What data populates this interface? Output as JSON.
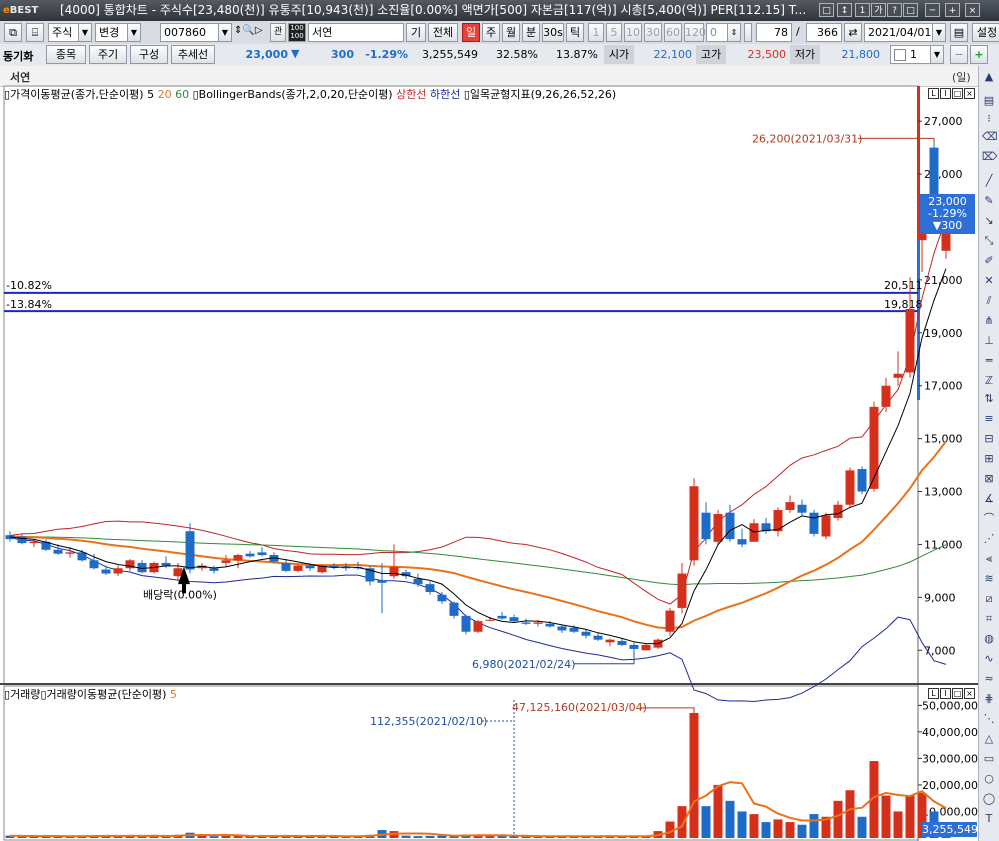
{
  "window": {
    "logo_prefix": "e",
    "logo_rest": "BEST",
    "title": "[4000] 통합차트 - 주식수[23,480(천)] 유통주[10,943(천)] 소진율[0.00%] 액면가[500] 자본금[117(억)] 시총[5,400(억)] PER[112.15] T..."
  },
  "toolbar": {
    "market": "주식",
    "change_btn": "변경",
    "code": "007860",
    "stock_name": "서연",
    "btn_gi": "기",
    "btn_all": "전체",
    "periods": [
      "일",
      "주",
      "월",
      "분",
      "30s",
      "틱"
    ],
    "active_period": "일",
    "minute_steps": [
      "1",
      "5",
      "10",
      "30",
      "60",
      "120"
    ],
    "offset": "0",
    "count_shown": "78",
    "count_total": "366",
    "date": "2021/04/01",
    "save_label": "설정"
  },
  "quotebar": {
    "sync_label": "동기화",
    "item_btn": "종목",
    "period_btn": "주기",
    "config_btn": "구성",
    "trend_btn": "추세선",
    "price": "23,000",
    "change": "300",
    "change_pct": "-1.29%",
    "volume": "3,255,549",
    "ratio1": "32.58%",
    "ratio2": "13.87%",
    "open_label": "시가",
    "open": "22,100",
    "high_label": "고가",
    "high": "23,500",
    "low_label": "저가",
    "low": "21,800",
    "pane_count": "1"
  },
  "chart_header": {
    "name": "서연",
    "unit": "(일)",
    "ma_label": "가격이동평균(종가,단순이평)",
    "ma_periods": [
      "5",
      "20",
      "60"
    ],
    "bb_label": "BollingerBands(종가,2,0,20,단순이평)",
    "bb_upper": "상한선",
    "bb_lower": "하한선",
    "ichimoku_label": "일목균형지표(9,26,26,52,26)"
  },
  "volume_header": {
    "label1": "거래량",
    "label2": "거래량이동평균(단순이평)",
    "period": "5"
  },
  "annotations": {
    "high": "26,200(2021/03/31)",
    "low": "6,980(2021/02/24)",
    "dividend": "배당락(0.00%)",
    "line1_pct": "-10.82%",
    "line1_val": "20,511",
    "line2_pct": "-13.84%",
    "line2_val": "19,818",
    "vol_max": "47,125,160(2021/03/04)",
    "vol_ref": "112,355(2021/02/10)",
    "price_box": [
      "23,000",
      "-1.29%",
      "▼300"
    ],
    "vol_box": "3,255,549"
  },
  "colors": {
    "up": "#d5301b",
    "down": "#1f6cc8",
    "ma5": "#000000",
    "ma20": "#e8731a",
    "ma60": "#2e8b3a",
    "bb_upper": "#c0262a",
    "bb_lower": "#1e2a9a",
    "hline": "#1d25c8"
  },
  "chart_data": {
    "type": "candlestick",
    "price_axis": {
      "ticks": [
        7000,
        9000,
        11000,
        13000,
        15000,
        17000,
        19000,
        21000,
        23000,
        25000,
        27000
      ],
      "labels": [
        "7,000",
        "9,000",
        "11,000",
        "13,000",
        "15,000",
        "17,000",
        "19,000",
        "21,000",
        "23,000",
        "25,000",
        "27,000"
      ],
      "range": [
        5800,
        27800
      ]
    },
    "volume_axis": {
      "ticks": [
        10000000,
        20000000,
        30000000,
        40000000,
        50000000
      ],
      "labels": [
        "10,000,000",
        "20,000,000",
        "30,000,000",
        "40,000,000",
        "50,000,000"
      ],
      "range": [
        0,
        52000000
      ]
    },
    "hlines": [
      20511,
      19818
    ],
    "candles": [
      [
        11350,
        11500,
        11100,
        11200,
        900000
      ],
      [
        11300,
        11400,
        11000,
        11050,
        700000
      ],
      [
        11050,
        11200,
        10900,
        11100,
        600000
      ],
      [
        11100,
        11200,
        10750,
        10800,
        800000
      ],
      [
        10800,
        11000,
        10600,
        10650,
        700000
      ],
      [
        10650,
        10900,
        10500,
        10700,
        600000
      ],
      [
        10700,
        10800,
        10350,
        10400,
        800000
      ],
      [
        10400,
        10650,
        10050,
        10100,
        900000
      ],
      [
        10050,
        10200,
        9850,
        9900,
        1000000
      ],
      [
        9900,
        10200,
        9800,
        10100,
        700000
      ],
      [
        10100,
        10450,
        10000,
        10400,
        800000
      ],
      [
        10300,
        10400,
        9900,
        9950,
        600000
      ],
      [
        9950,
        10350,
        9900,
        10300,
        1000000
      ],
      [
        10300,
        10550,
        10100,
        10200,
        700000
      ],
      [
        9800,
        10300,
        9600,
        10100,
        1200000
      ],
      [
        11500,
        11800,
        9900,
        10050,
        2000000
      ],
      [
        10100,
        10300,
        10000,
        10200,
        800000
      ],
      [
        10100,
        10200,
        9900,
        10000,
        700000
      ],
      [
        10300,
        10600,
        10150,
        10400,
        900000
      ],
      [
        10400,
        10650,
        10100,
        10600,
        800000
      ],
      [
        10650,
        10750,
        10500,
        10550,
        600000
      ],
      [
        10700,
        10900,
        10550,
        10600,
        700000
      ],
      [
        10600,
        10700,
        10300,
        10350,
        800000
      ],
      [
        10300,
        10450,
        9950,
        10000,
        1000000
      ],
      [
        10000,
        10250,
        9950,
        10200,
        700000
      ],
      [
        10200,
        10300,
        10000,
        10100,
        600000
      ],
      [
        9950,
        10250,
        9900,
        10200,
        800000
      ],
      [
        10200,
        10300,
        10050,
        10150,
        700000
      ],
      [
        10150,
        10300,
        10000,
        10100,
        600000
      ],
      [
        10150,
        10350,
        10050,
        10100,
        700000
      ],
      [
        10100,
        10200,
        9450,
        9600,
        1200000
      ],
      [
        9650,
        10300,
        8400,
        9550,
        3000000
      ],
      [
        9800,
        11000,
        9700,
        10150,
        2600000
      ],
      [
        9950,
        10050,
        9700,
        9800,
        900000
      ],
      [
        9700,
        9900,
        9400,
        9500,
        700000
      ],
      [
        9500,
        9600,
        9100,
        9200,
        800000
      ],
      [
        9100,
        9200,
        8750,
        8850,
        900000
      ],
      [
        8800,
        8850,
        8200,
        8300,
        1100000
      ],
      [
        8300,
        8350,
        7600,
        7700,
        1300000
      ],
      [
        7700,
        8150,
        7650,
        8100,
        1000000
      ],
      [
        8150,
        8250,
        8100,
        8150,
        800000
      ],
      [
        8300,
        8450,
        8150,
        8200,
        800000
      ],
      [
        8250,
        8350,
        8050,
        8100,
        700000
      ],
      [
        8050,
        8200,
        7950,
        8000,
        700000
      ],
      [
        8000,
        8150,
        7900,
        8050,
        600000
      ],
      [
        8000,
        8100,
        7850,
        7900,
        600000
      ],
      [
        7900,
        7950,
        7650,
        7750,
        800000
      ],
      [
        7850,
        7950,
        7650,
        7700,
        700000
      ],
      [
        7700,
        7800,
        7450,
        7550,
        700000
      ],
      [
        7550,
        7650,
        7350,
        7400,
        600000
      ],
      [
        7300,
        7450,
        7150,
        7400,
        700000
      ],
      [
        7350,
        7450,
        7150,
        7200,
        600000
      ],
      [
        7200,
        7300,
        6980,
        7050,
        700000
      ],
      [
        7000,
        7250,
        6980,
        7200,
        800000
      ],
      [
        7100,
        7450,
        7050,
        7400,
        2600000
      ],
      [
        7700,
        8600,
        7550,
        8500,
        6200000
      ],
      [
        8600,
        10300,
        8400,
        9900,
        12000000
      ],
      [
        10400,
        13500,
        10200,
        13200,
        47125160
      ],
      [
        12200,
        12600,
        11000,
        11200,
        12000000
      ],
      [
        11100,
        12300,
        11000,
        12150,
        20000000
      ],
      [
        12200,
        12500,
        11100,
        11200,
        14000000
      ],
      [
        11200,
        11600,
        10900,
        11000,
        10000000
      ],
      [
        11100,
        11950,
        11100,
        11800,
        9000000
      ],
      [
        11800,
        12000,
        11400,
        11500,
        6000000
      ],
      [
        11500,
        12400,
        11300,
        12300,
        7000000
      ],
      [
        12300,
        12850,
        12200,
        12600,
        6000000
      ],
      [
        12500,
        12700,
        12100,
        12200,
        5000000
      ],
      [
        12200,
        12300,
        11300,
        11400,
        9000000
      ],
      [
        11300,
        12200,
        11200,
        12100,
        8000000
      ],
      [
        12000,
        12650,
        11900,
        12500,
        14000000
      ],
      [
        12500,
        13900,
        12400,
        13800,
        18000000
      ],
      [
        13850,
        13950,
        12900,
        13000,
        8000000
      ],
      [
        13100,
        16400,
        13000,
        16200,
        29000000
      ],
      [
        16200,
        17300,
        16000,
        17000,
        16000000
      ],
      [
        17300,
        18300,
        17000,
        17450,
        10000000
      ],
      [
        17500,
        21100,
        17300,
        19900,
        16000000
      ],
      [
        22500,
        24200,
        21300,
        23500,
        17000000
      ],
      [
        26000,
        26200,
        23500,
        23300,
        10000000
      ],
      [
        22100,
        23500,
        21800,
        23000,
        3255549
      ]
    ]
  }
}
